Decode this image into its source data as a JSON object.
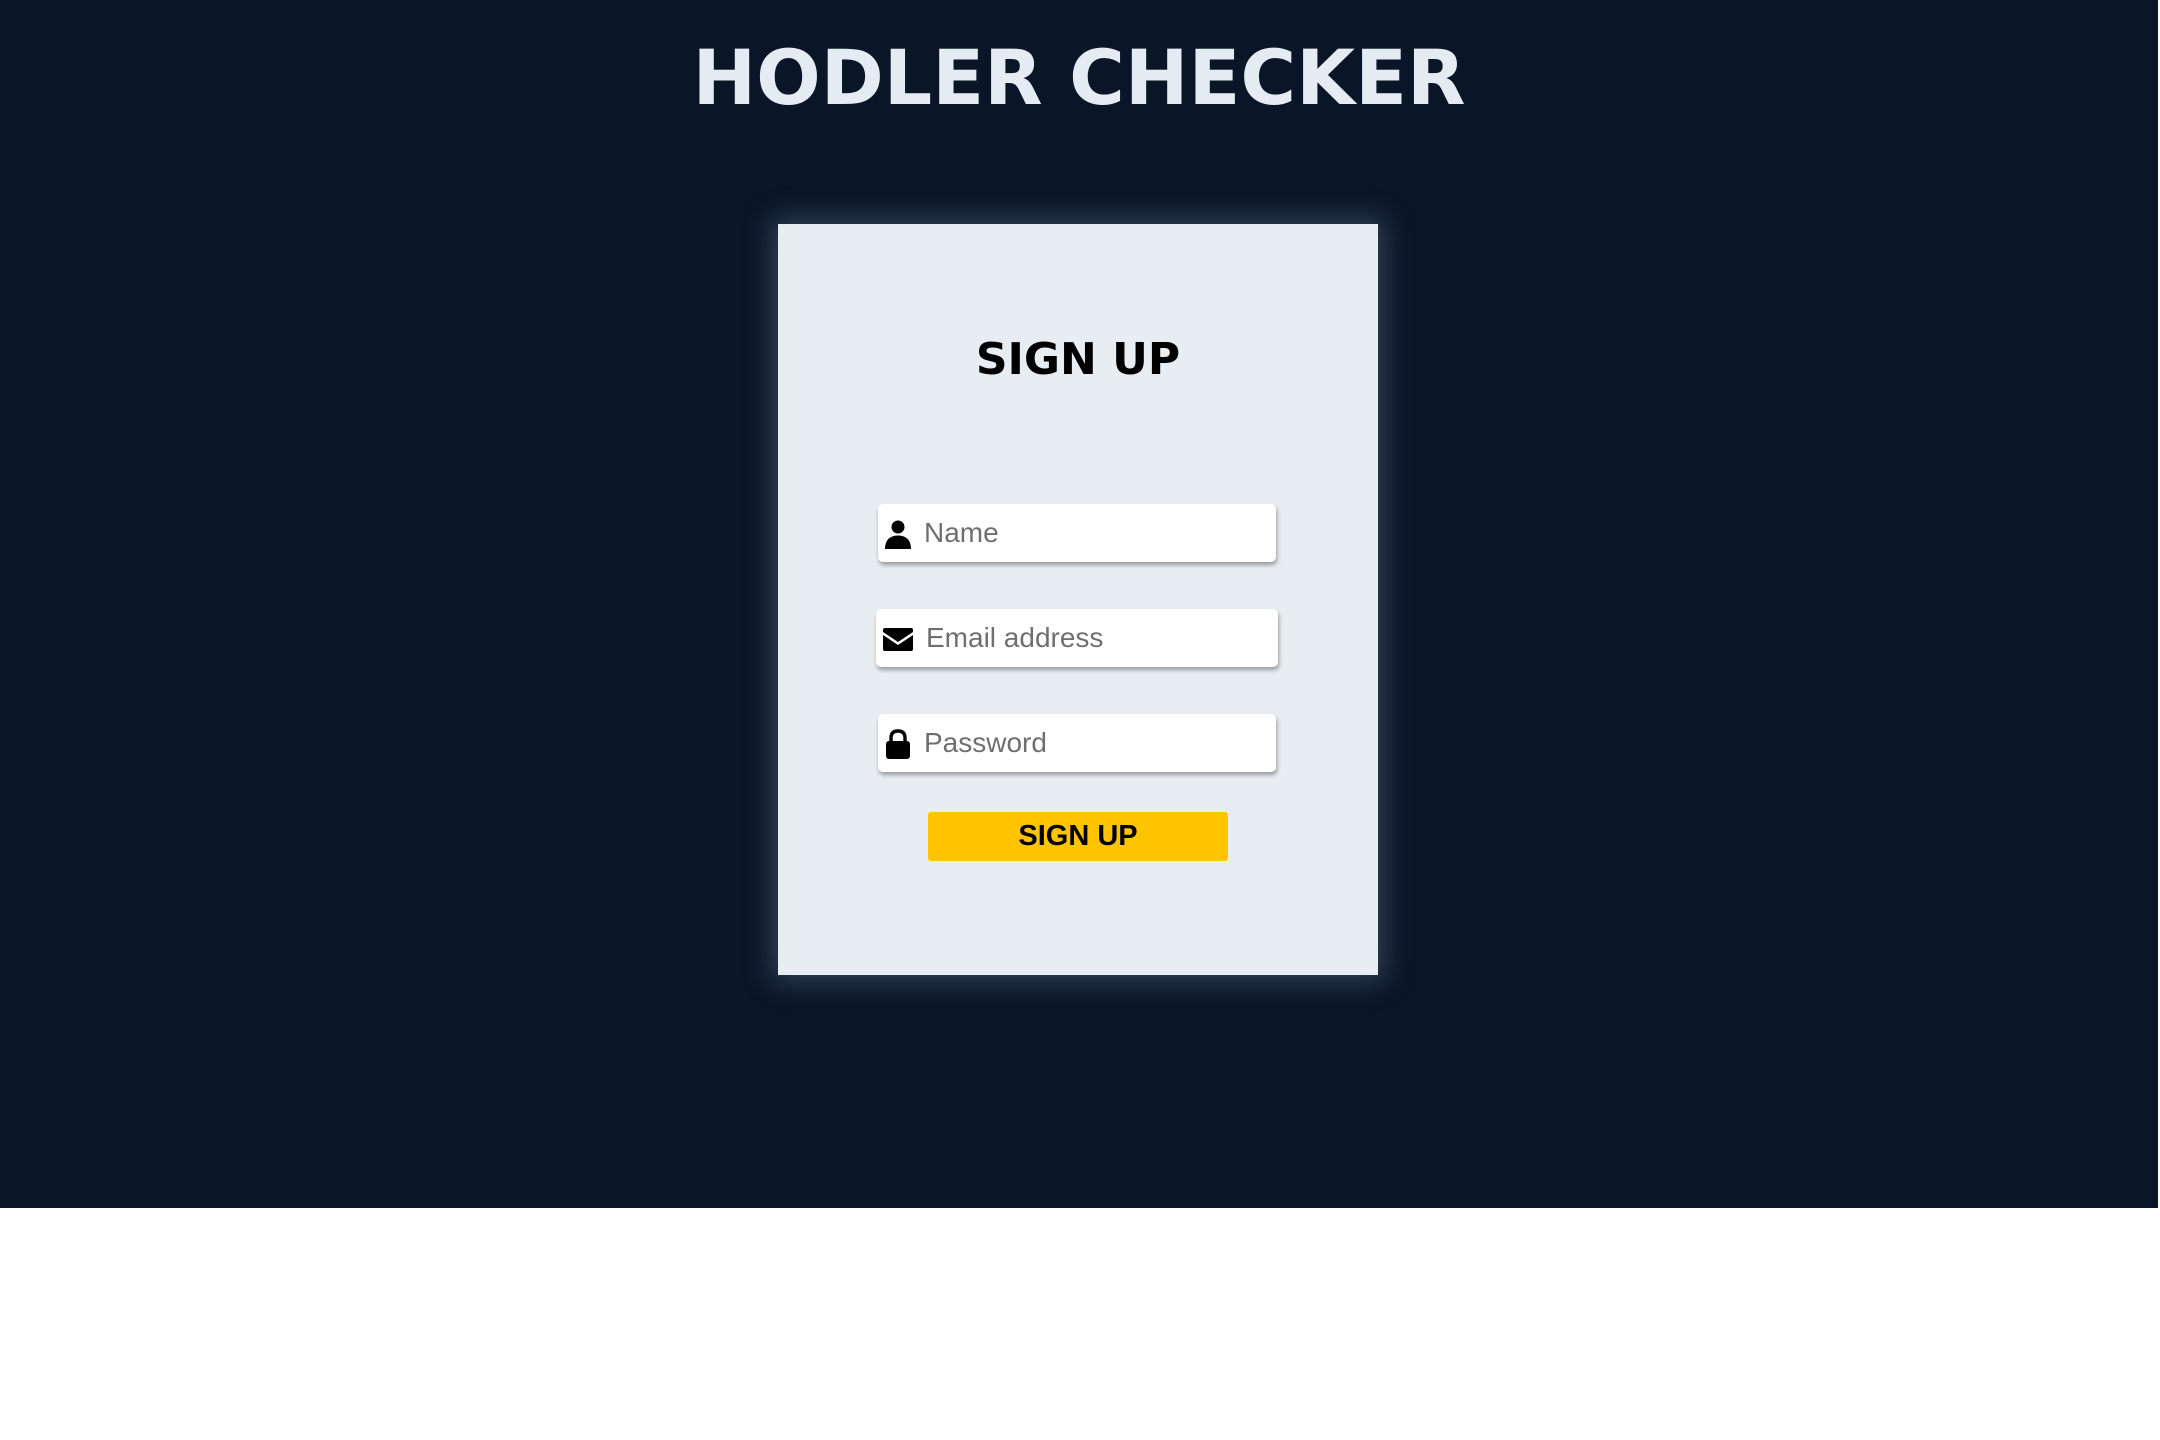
{
  "app": {
    "title": "HODLER CHECKER"
  },
  "signup_form": {
    "heading": "SIGN UP",
    "fields": {
      "name": {
        "placeholder": "Name",
        "value": "",
        "icon": "user-icon"
      },
      "email": {
        "placeholder": "Email address",
        "value": "",
        "icon": "envelope-icon"
      },
      "password": {
        "placeholder": "Password",
        "value": "",
        "icon": "lock-icon"
      }
    },
    "submit_label": "SIGN UP"
  },
  "colors": {
    "background": "#0a1628",
    "card": "#e8edf2",
    "title_text": "#e4ebf2",
    "button": "#ffc400"
  }
}
